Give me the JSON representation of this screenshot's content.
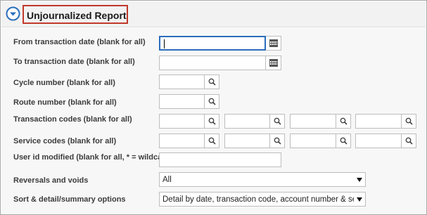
{
  "report": {
    "title": "Unjournalized Report"
  },
  "fields": {
    "from_date": {
      "label": "From transaction date (blank for all)",
      "value": ""
    },
    "to_date": {
      "label": "To transaction date (blank for all)",
      "value": ""
    },
    "cycle": {
      "label": "Cycle number (blank for all)",
      "value": ""
    },
    "route": {
      "label": "Route number (blank for all)",
      "value": ""
    },
    "transaction_codes": {
      "label": "Transaction codes (blank for all)",
      "values": [
        "",
        "",
        "",
        ""
      ]
    },
    "service_codes": {
      "label": "Service codes (blank for all)",
      "values": [
        "",
        "",
        "",
        ""
      ]
    },
    "user_id": {
      "label": "User id modified (blank for all, * = wildcard)",
      "value": ""
    },
    "reversals": {
      "label": "Reversals and voids",
      "selected": "All"
    },
    "sort": {
      "label": "Sort & detail/summary options",
      "selected": "Detail by date, transaction code, account number & service"
    }
  },
  "icons": {
    "collapse": "circle-chevron-down-icon",
    "calendar": "calendar-icon",
    "search": "search-icon",
    "dropdown": "caret-down-icon"
  },
  "colors": {
    "accent": "#2a6ebb",
    "title_outline": "#c0392b",
    "header_bg": "#f2f2f2",
    "panel_bg": "#f7f7f7"
  }
}
